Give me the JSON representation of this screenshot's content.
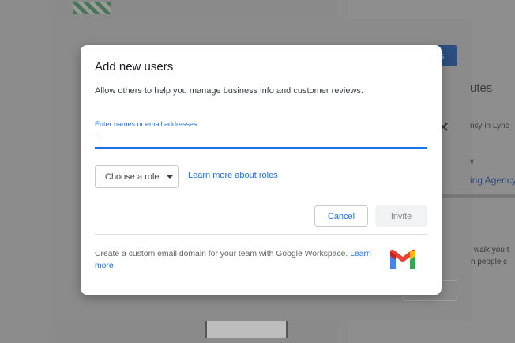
{
  "background": {
    "outer_dialog": {
      "primary_button_label": "s",
      "title": "utes",
      "line1": "ncy in Lync",
      "line2": "v",
      "link": "ing Agency",
      "line3": "walk you t",
      "line4": "n people c",
      "close_glyph": "✕"
    }
  },
  "dialog": {
    "title": "Add new users",
    "description": "Allow others to help you manage business info and customer reviews.",
    "field": {
      "label": "Enter names or email addresses",
      "value": ""
    },
    "role_select": {
      "label": "Choose a role",
      "icon": "dropdown-arrow-icon"
    },
    "learn_roles_link": "Learn more about roles",
    "buttons": {
      "cancel": "Cancel",
      "invite": "Invite"
    },
    "promo": {
      "text": "Create a custom email domain for your team with Google Workspace. ",
      "link": "Learn more",
      "icon": "gmail-logo-icon"
    }
  },
  "colors": {
    "accent": "#1a73e8",
    "gmail_red": "#ea4335",
    "gmail_blue": "#4285f4",
    "gmail_green": "#34a853",
    "gmail_yellow": "#fbbc04"
  }
}
